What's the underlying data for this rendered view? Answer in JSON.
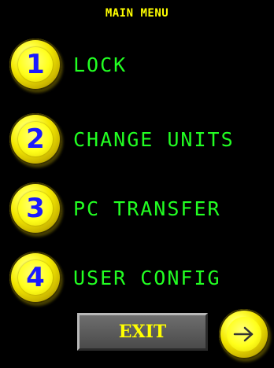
{
  "screen": {
    "title": "MAIN MENU"
  },
  "menu": {
    "items": [
      {
        "number": "1",
        "label": "LOCK"
      },
      {
        "number": "2",
        "label": "CHANGE UNITS"
      },
      {
        "number": "3",
        "label": "PC TRANSFER"
      },
      {
        "number": "4",
        "label": "USER CONFIG"
      }
    ]
  },
  "footer": {
    "exit_label": "EXIT",
    "next_icon": "right-arrow-icon"
  },
  "colors": {
    "background": "#000000",
    "title": "#ffff00",
    "menu_label": "#22ff22",
    "button_yellow": "#ffff00",
    "digit": "#1a1aff",
    "exit_button": "#5a5a5a"
  }
}
